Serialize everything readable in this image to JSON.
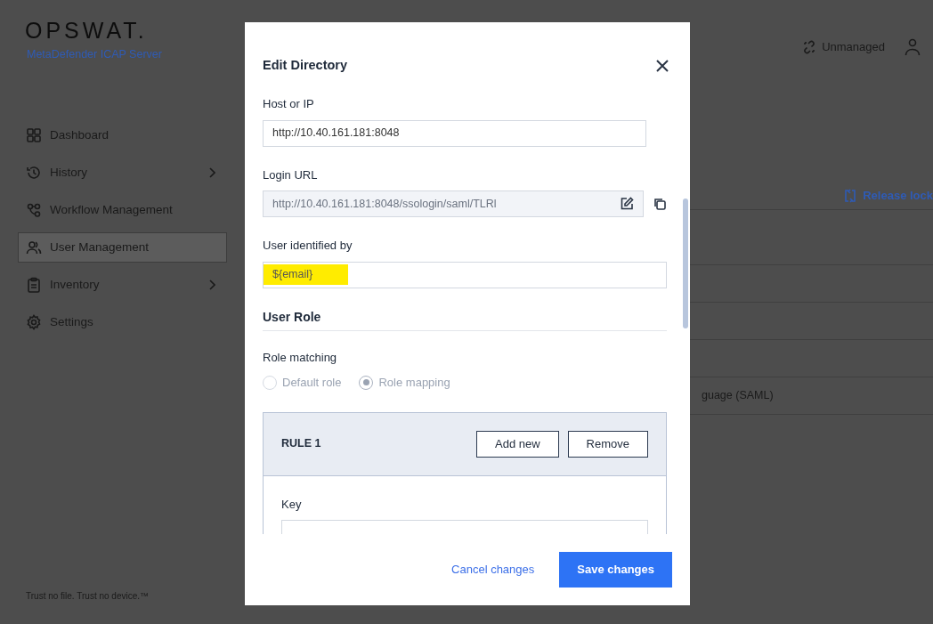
{
  "brand": {
    "logo": "OPSWAT.",
    "product": "MetaDefender ICAP Server"
  },
  "header": {
    "status": "Unmanaged"
  },
  "sidebar": {
    "items": [
      {
        "label": "Dashboard",
        "selected": false,
        "expandable": false
      },
      {
        "label": "History",
        "selected": false,
        "expandable": true
      },
      {
        "label": "Workflow Management",
        "selected": false,
        "expandable": false
      },
      {
        "label": "User Management",
        "selected": true,
        "expandable": false
      },
      {
        "label": "Inventory",
        "selected": false,
        "expandable": true
      },
      {
        "label": "Settings",
        "selected": false,
        "expandable": false
      }
    ],
    "footer": "Trust no file. Trust no device.™"
  },
  "main": {
    "release_lock": "Release lock",
    "rows": [
      "",
      "",
      "",
      "",
      "guage (SAML)"
    ]
  },
  "dialog": {
    "title": "Edit Directory",
    "fields": [
      {
        "kind": "text",
        "label": "Host or IP",
        "value": "http://10.40.161.181:8048"
      },
      {
        "kind": "readonly",
        "label": "Login URL",
        "value": "http://10.40.161.181:8048/ssologin/saml/TLRl"
      },
      {
        "kind": "highlight",
        "label": "User identified by",
        "value": "${email}"
      }
    ],
    "section": "User Role",
    "role_matching": {
      "label": "Role matching",
      "disabled": true,
      "options": [
        {
          "label": "Default role",
          "selected": false
        },
        {
          "label": "Role mapping",
          "selected": true
        }
      ]
    },
    "rule": {
      "title": "RULE 1",
      "buttons": [
        "Add new",
        "Remove"
      ],
      "key_label": "Key"
    },
    "cancel": "Cancel changes",
    "save": "Save changes"
  }
}
